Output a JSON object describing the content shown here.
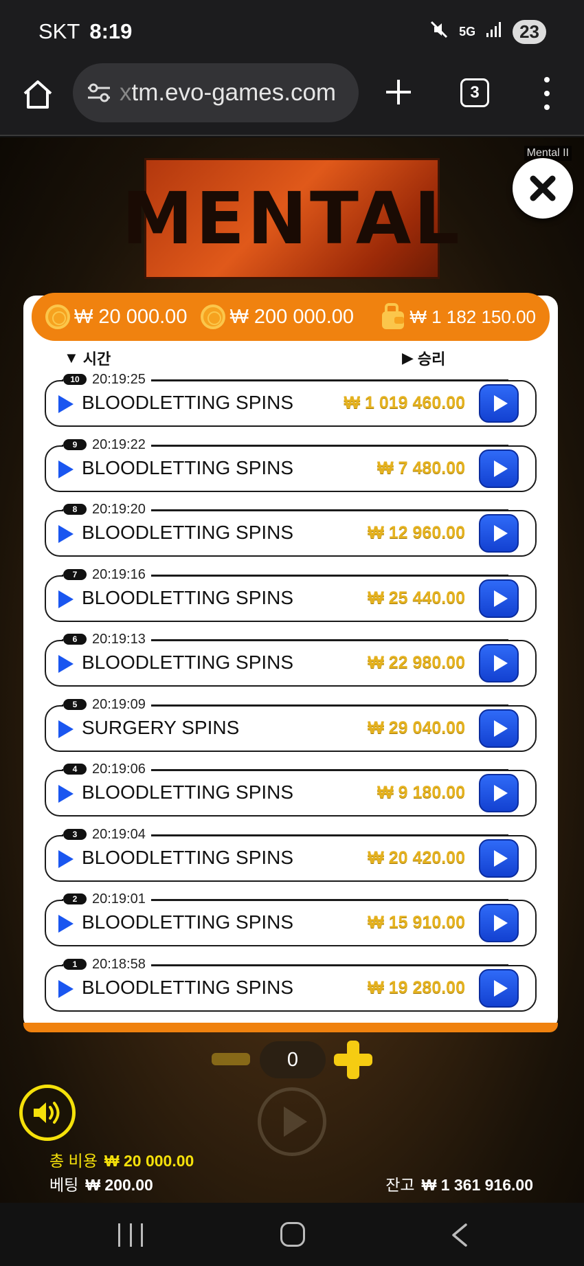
{
  "status": {
    "carrier": "SKT",
    "time": "8:19",
    "network": "5G",
    "battery": "23"
  },
  "browser": {
    "url_prefix": "x",
    "url": "tm.evo-games.com",
    "tab_count": "3"
  },
  "game": {
    "label": "Mental II",
    "logo_text": "MENTAL",
    "header": {
      "coin_value": "₩ 20 000.00",
      "bet_value": "₩ 200 000.00",
      "wallet_value": "₩ 1 182 150.00"
    },
    "columns": {
      "time": "시간",
      "win": "승리"
    },
    "history": [
      {
        "index": "10",
        "time": "20:19:25",
        "name": "BLOODLETTING SPINS",
        "amount": "₩ 1 019 460.00"
      },
      {
        "index": "9",
        "time": "20:19:22",
        "name": "BLOODLETTING SPINS",
        "amount": "₩ 7 480.00"
      },
      {
        "index": "8",
        "time": "20:19:20",
        "name": "BLOODLETTING SPINS",
        "amount": "₩ 12 960.00"
      },
      {
        "index": "7",
        "time": "20:19:16",
        "name": "BLOODLETTING SPINS",
        "amount": "₩ 25 440.00"
      },
      {
        "index": "6",
        "time": "20:19:13",
        "name": "BLOODLETTING SPINS",
        "amount": "₩ 22 980.00"
      },
      {
        "index": "5",
        "time": "20:19:09",
        "name": "SURGERY SPINS",
        "amount": "₩ 29 040.00"
      },
      {
        "index": "4",
        "time": "20:19:06",
        "name": "BLOODLETTING SPINS",
        "amount": "₩ 9 180.00"
      },
      {
        "index": "3",
        "time": "20:19:04",
        "name": "BLOODLETTING SPINS",
        "amount": "₩ 20 420.00"
      },
      {
        "index": "2",
        "time": "20:19:01",
        "name": "BLOODLETTING SPINS",
        "amount": "₩ 15 910.00"
      },
      {
        "index": "1",
        "time": "20:18:58",
        "name": "BLOODLETTING SPINS",
        "amount": "₩ 19 280.00"
      }
    ],
    "counter": "0",
    "total_cost_label": "총 비용",
    "total_cost_value": "₩ 20 000.00",
    "bet_label": "베팅",
    "bet_value": "₩ 200.00",
    "balance_label": "잔고",
    "balance_value": "₩ 1 361 916.00"
  },
  "colors": {
    "accent": "#f0820f",
    "play_blue": "#1a56f0",
    "amount_gold": "#e5b21f",
    "sound_yellow": "#f5e10a"
  }
}
